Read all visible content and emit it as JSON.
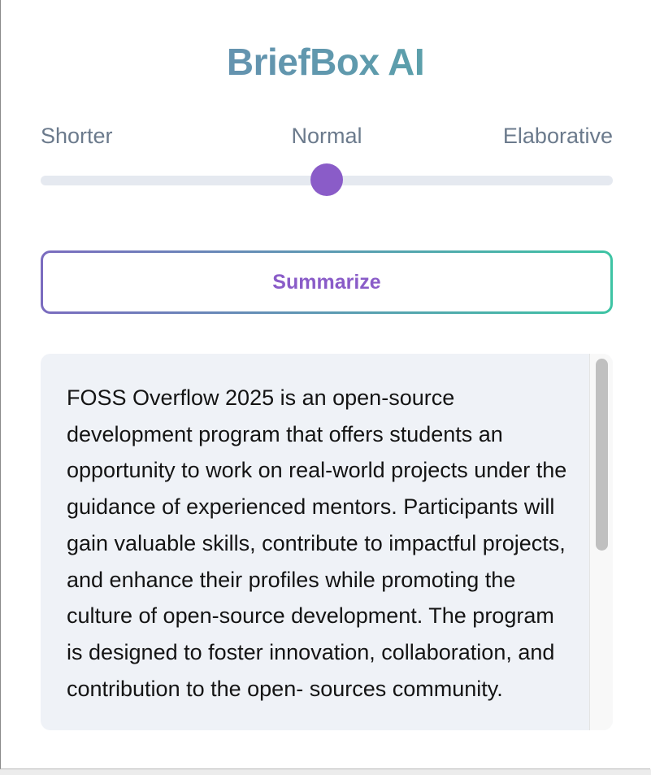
{
  "app": {
    "title": "BriefBox AI"
  },
  "length_slider": {
    "labels": [
      "Shorter",
      "Normal",
      "Elaborative"
    ],
    "selected": "Normal",
    "value_fraction": 0.5,
    "thumb_color": "#8a5cc8"
  },
  "summarize_button": {
    "label": "Summarize"
  },
  "output": {
    "text": "FOSS Overflow 2025 is an open-source development program that offers students an opportunity to work on real-world projects under the guidance of experienced mentors. Participants will gain valuable skills, contribute to impactful projects, and enhance their profiles while promoting the culture of open-source development. The program is designed to foster innovation, collaboration, and contribution to the open- sources community."
  },
  "colors": {
    "accent_purple": "#8a5cc8",
    "accent_teal": "#3ec4a4",
    "panel_bg": "#eff2f7"
  }
}
